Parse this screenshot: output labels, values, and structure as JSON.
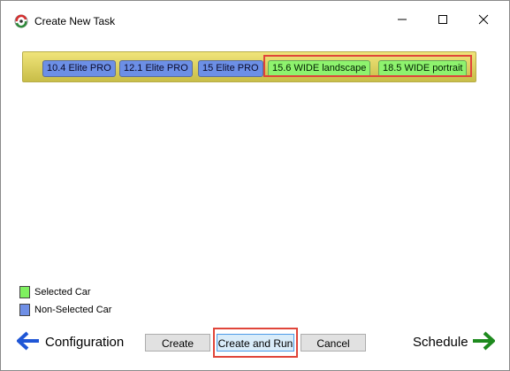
{
  "window": {
    "title": "Create New Task",
    "icons": {
      "app": "app-logo-icon",
      "minimize": "minimize-icon",
      "maximize": "maximize-icon",
      "close": "close-icon"
    }
  },
  "cars": [
    {
      "label": "10.4 Elite PRO",
      "state": "non-selected"
    },
    {
      "label": "12.1 Elite PRO",
      "state": "non-selected"
    },
    {
      "label": "15 Elite PRO",
      "state": "non-selected"
    },
    {
      "label": "15.6 WIDE landscape",
      "state": "selected"
    },
    {
      "label": "18.5 WIDE portrait",
      "state": "selected"
    }
  ],
  "legend": {
    "selected": "Selected Car",
    "non_selected": "Non-Selected Car"
  },
  "nav": {
    "back_label": "Configuration",
    "forward_label": "Schedule"
  },
  "buttons": {
    "create": "Create",
    "create_and_run": "Create and Run",
    "cancel": "Cancel"
  },
  "colors": {
    "selected": "#8ef36e",
    "non_selected": "#6c8fe6",
    "bar": "#e3d865",
    "back_arrow": "#1f56d6",
    "forward_arrow": "#1e8a1e",
    "highlight": "#e0453a"
  }
}
